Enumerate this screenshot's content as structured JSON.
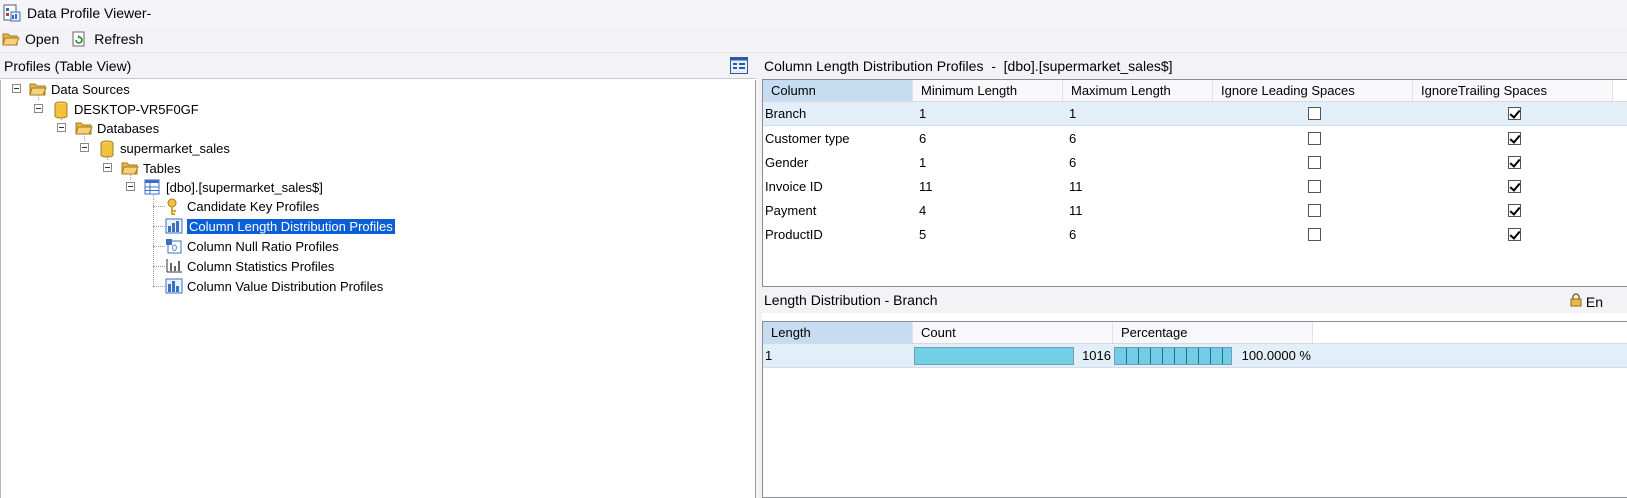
{
  "window": {
    "title": "Data Profile Viewer-"
  },
  "toolbar": {
    "open_label": "Open",
    "refresh_label": "Refresh"
  },
  "left_pane": {
    "header": "Profiles (Table View)",
    "tree": {
      "data_sources": "Data Sources",
      "server": "DESKTOP-VR5F0GF",
      "databases": "Databases",
      "database": "supermarket_sales",
      "tables": "Tables",
      "table": "[dbo].[supermarket_sales$]",
      "profiles": [
        {
          "label": "Candidate Key Profiles",
          "icon": "key-icon"
        },
        {
          "label": "Column Length Distribution Profiles",
          "icon": "length-distribution-icon",
          "selected": true
        },
        {
          "label": "Column Null Ratio Profiles",
          "icon": "null-ratio-icon"
        },
        {
          "label": "Column Statistics Profiles",
          "icon": "statistics-icon"
        },
        {
          "label": "Column Value Distribution Profiles",
          "icon": "value-distribution-icon"
        }
      ]
    }
  },
  "right_pane": {
    "header": "Column Length Distribution Profiles  -  [dbo].[supermarket_sales$]",
    "columns_table": {
      "headers": [
        "Column",
        "Minimum Length",
        "Maximum Length",
        "Ignore Leading Spaces",
        "IgnoreTrailing Spaces"
      ],
      "rows": [
        {
          "column": "Branch",
          "min": "1",
          "max": "1",
          "ignore_leading": false,
          "ignore_trailing": true,
          "selected": true
        },
        {
          "column": "Customer type",
          "min": "6",
          "max": "6",
          "ignore_leading": false,
          "ignore_trailing": true
        },
        {
          "column": "Gender",
          "min": "1",
          "max": "6",
          "ignore_leading": false,
          "ignore_trailing": true
        },
        {
          "column": "Invoice ID",
          "min": "11",
          "max": "11",
          "ignore_leading": false,
          "ignore_trailing": true
        },
        {
          "column": "Payment",
          "min": "4",
          "max": "11",
          "ignore_leading": false,
          "ignore_trailing": true
        },
        {
          "column": "ProductID",
          "min": "5",
          "max": "6",
          "ignore_leading": false,
          "ignore_trailing": true
        }
      ]
    },
    "distribution": {
      "header": "Length Distribution - Branch",
      "lock_label": "En",
      "headers": [
        "Length",
        "Count",
        "Percentage"
      ],
      "rows": [
        {
          "length": "1",
          "count": "1016",
          "count_fill": 1.0,
          "percentage": "100.0000 %",
          "percentage_fill": 1.0
        }
      ]
    }
  },
  "colors": {
    "selection": "#0a5fd6",
    "header_highlight": "#c6dcf0",
    "bar_fill": "#6fd0e6"
  }
}
